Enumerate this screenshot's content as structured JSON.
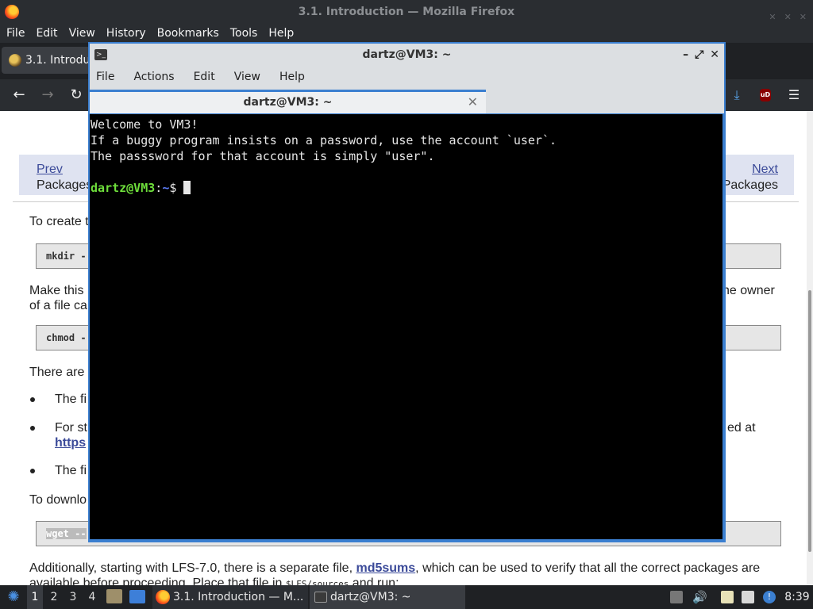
{
  "firefox": {
    "window_title": "3.1. Introduction — Mozilla Firefox",
    "menu": [
      "File",
      "Edit",
      "View",
      "History",
      "Bookmarks",
      "Tools",
      "Help"
    ],
    "tab_title": "3.1. Introdu",
    "page": {
      "prev_link": "Prev",
      "prev_title": "Packages",
      "next_link": "Next",
      "next_title": "Packages",
      "line_create": "To create t",
      "code_mkdir": "mkdir -",
      "line_make_a": "Make this",
      "line_make_b": "he owner",
      "line_make_c": "of a file ca",
      "code_chmod": "chmod -",
      "line_there": "There are",
      "bullet1": "The fi",
      "bullet2_a": "For st",
      "bullet2_b": "ed at",
      "bullet2_link": "https",
      "bullet3": "The fi",
      "line_download": "To downlo",
      "code_wget": "wget --",
      "line_additionally_pre": "Additionally, starting with LFS-7.0, there is a separate file, ",
      "line_additionally_link": "md5sums",
      "line_additionally_post": ", which can be used to verify that all the correct packages are",
      "line_available_pre": "available before proceeding. Place that file in ",
      "line_available_code": "$LFS/sources",
      "line_available_post": " and run:"
    }
  },
  "terminal": {
    "title": "dartz@VM3: ~",
    "menu": [
      "File",
      "Actions",
      "Edit",
      "View",
      "Help"
    ],
    "tab_title": "dartz@VM3: ~",
    "lines": [
      "Welcome to VM3!",
      "If a buggy program insists on a password, use the account `user`.",
      "The passsword for that account is simply \"user\"."
    ],
    "prompt_user": "dartz@VM3",
    "prompt_sep": ":",
    "prompt_path": "~",
    "prompt_symbol": "$ "
  },
  "taskbar": {
    "workspaces": [
      "1",
      "2",
      "3",
      "4"
    ],
    "tasks": [
      {
        "label": "3.1. Introduction — M..."
      },
      {
        "label": "dartz@VM3: ~"
      }
    ],
    "clock": "8:39"
  },
  "colors": {
    "terminal_frame": "#3b7fd0",
    "prompt_user": "#6ede3b",
    "prompt_path": "#5b7bf4",
    "link": "#3b4a99"
  }
}
